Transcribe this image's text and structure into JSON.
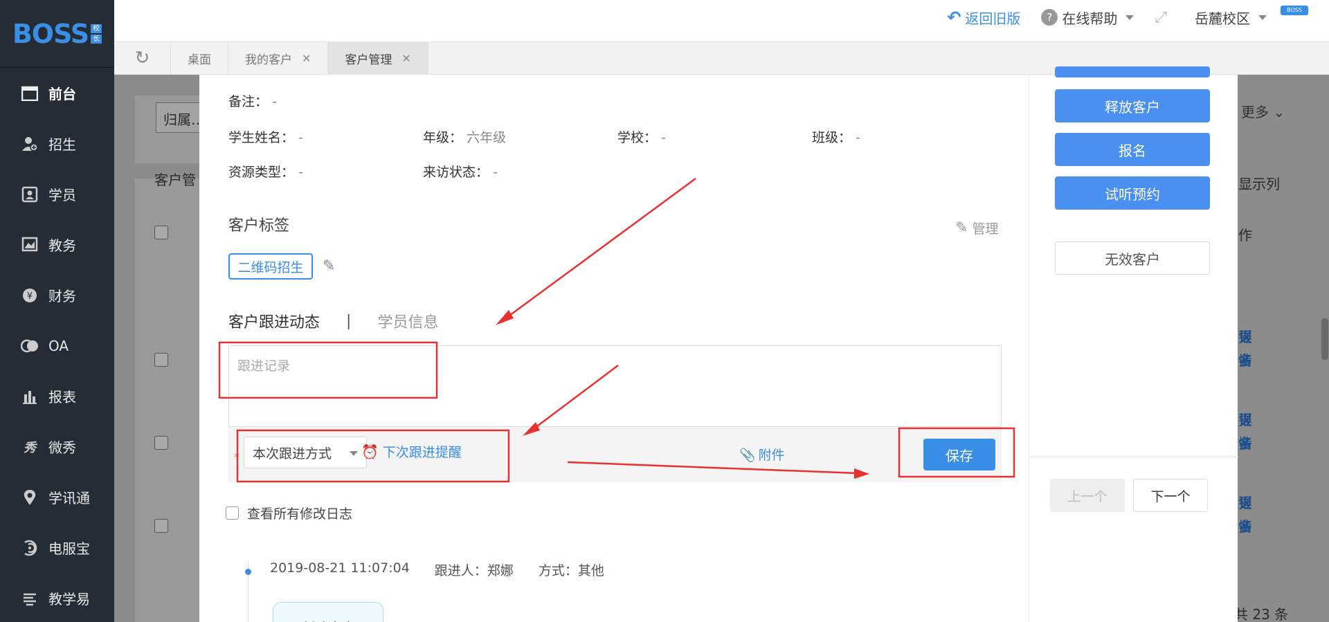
{
  "sidebar": {
    "logo": "BOSS",
    "logo_badge": [
      "校",
      "长"
    ],
    "items": [
      {
        "label": "前台",
        "icon": "calendar-icon"
      },
      {
        "label": "招生",
        "icon": "user-add-icon"
      },
      {
        "label": "学员",
        "icon": "id-card-icon"
      },
      {
        "label": "教务",
        "icon": "book-icon"
      },
      {
        "label": "财务",
        "icon": "yen-icon"
      },
      {
        "label": "OA",
        "icon": "oa-icon"
      },
      {
        "label": "报表",
        "icon": "bar-chart-icon"
      },
      {
        "label": "微秀",
        "icon": "wei-xiu-icon"
      },
      {
        "label": "学讯通",
        "icon": "location-icon"
      },
      {
        "label": "电服宝",
        "icon": "phone-service-icon"
      },
      {
        "label": "教学易",
        "icon": "teach-icon"
      }
    ]
  },
  "header": {
    "back_old": "返回旧版",
    "help": "在线帮助",
    "campus": "岳麓校区",
    "boss_tag": "BOSS"
  },
  "tabs": [
    {
      "label": "桌面",
      "closable": false
    },
    {
      "label": "我的客户",
      "closable": true
    },
    {
      "label": "客户管理",
      "closable": true,
      "active": true
    }
  ],
  "background": {
    "filter_placeholder": "归属…",
    "more": "更多",
    "list_title": "客户管",
    "display_columns": "显示列",
    "col_action": "作",
    "row_links": [
      "详情",
      "报名",
      "更多"
    ],
    "total": "共 23 条"
  },
  "detail": {
    "remark_label": "备注：",
    "remark_value": "-",
    "fields": [
      {
        "label": "学生姓名：",
        "value": "-"
      },
      {
        "label": "年级：",
        "value": "六年级"
      },
      {
        "label": "学校：",
        "value": "-"
      },
      {
        "label": "班级：",
        "value": "-"
      },
      {
        "label": "资源类型：",
        "value": "-"
      },
      {
        "label": "来访状态：",
        "value": "-"
      }
    ],
    "tag_section": "客户标签",
    "manage": "管理",
    "tag": "二维码招生",
    "tab_follow": "客户跟进动态",
    "tab_sep": "|",
    "tab_student": "学员信息",
    "followup_placeholder": "跟进记录",
    "required_star": "*",
    "method_select": "本次跟进方式",
    "next_reminder": "下次跟进提醒",
    "attachment": "附件",
    "save": "保存",
    "view_logs": "查看所有修改日志",
    "log": {
      "time": "2019-08-21 11:07:04",
      "follower": "跟进人：郑娜",
      "method": "方式：其他",
      "content": "新建客户"
    }
  },
  "actions": {
    "release": "释放客户",
    "enroll": "报名",
    "trial": "试听预约",
    "invalid": "无效客户",
    "prev": "上一个",
    "next": "下一个"
  },
  "colors": {
    "primary": "#3a8ee6",
    "annotation": "#e8312f",
    "sidebar_bg": "#262c33"
  }
}
